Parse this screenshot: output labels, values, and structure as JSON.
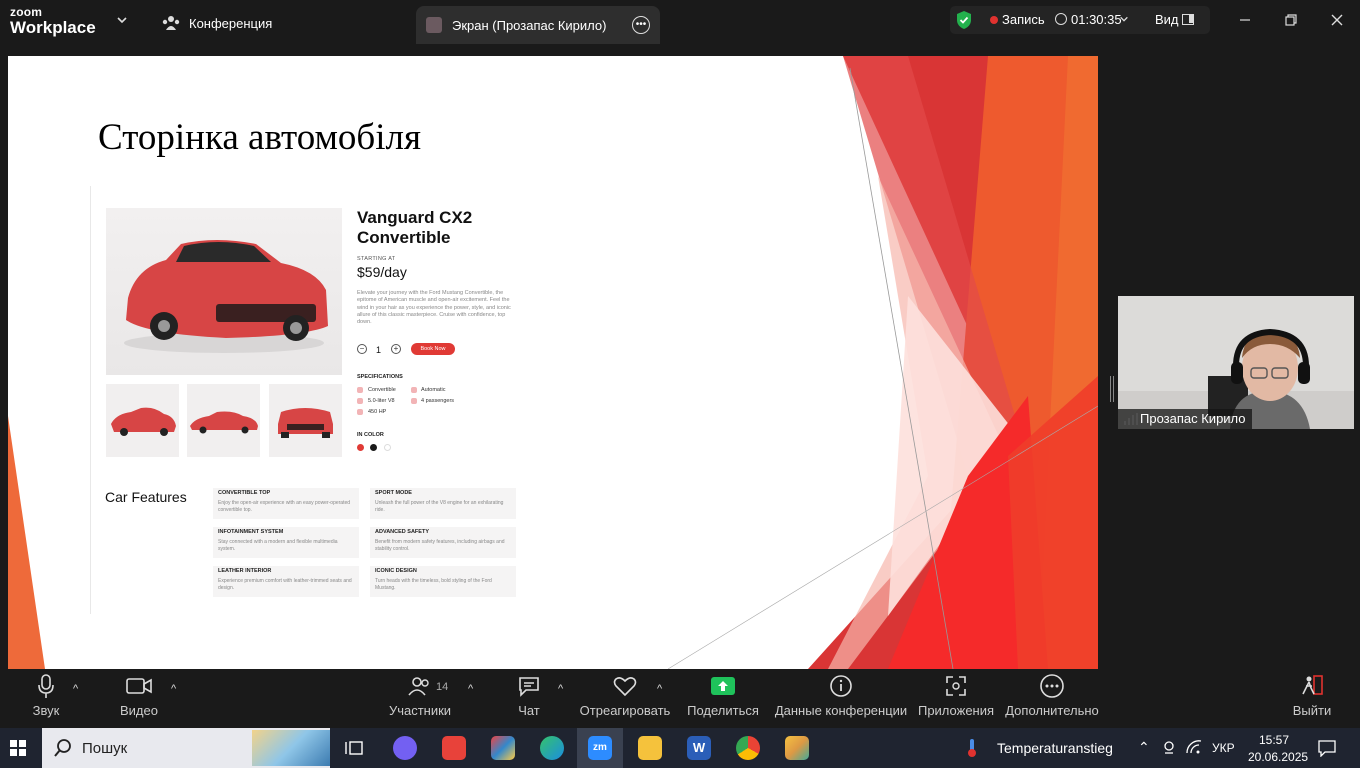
{
  "app": {
    "logo_line1": "zoom",
    "logo_line2": "Workplace",
    "meeting_tab": "Конференция",
    "share_tab": "Экран (Прозапас Кирило)",
    "recording_label": "Запись",
    "timer": "01:30:35",
    "view_label": "Вид"
  },
  "slide": {
    "title": "Сторінка автомобіля",
    "car_name": "Vanguard CX2 Convertible",
    "starting_at": "STARTING AT",
    "price": "$59/day",
    "description": "Elevate your journey with the Ford Mustang Convertible, the epitome of American muscle and open-air excitement. Feel the wind in your hair as you experience the power, style, and iconic allure of this classic masterpiece. Cruise with confidence, top down.",
    "quantity": "1",
    "book_button": "Book Now",
    "specifications_title": "SPECIFICATIONS",
    "specs": [
      "Convertible",
      "Automatic",
      "5.0-liter V8",
      "4 passengers",
      "450 HP"
    ],
    "in_color": "IN COLOR",
    "colors": [
      "#e03a35",
      "#1a1a1a",
      "#ffffff"
    ],
    "features_title": "Car Features",
    "features": [
      {
        "title": "CONVERTIBLE TOP",
        "desc": "Enjoy the open-air experience with an easy power-operated convertible top."
      },
      {
        "title": "SPORT MODE",
        "desc": "Unleash the full power of the V8 engine for an exhilarating ride."
      },
      {
        "title": "INFOTAINMENT SYSTEM",
        "desc": "Stay connected with a modern and flexible multimedia system."
      },
      {
        "title": "ADVANCED SAFETY",
        "desc": "Benefit from modern safety features, including airbags and stability control."
      },
      {
        "title": "LEATHER INTERIOR",
        "desc": "Experience premium comfort with leather-trimmed seats and design."
      },
      {
        "title": "ICONIC DESIGN",
        "desc": "Turn heads with the timeless, bold styling of the Ford Mustang."
      }
    ]
  },
  "video": {
    "participant_name": "Прозапас Кирило"
  },
  "toolbar": {
    "audio": "Звук",
    "video": "Видео",
    "participants": "Участники",
    "participants_count": "14",
    "chat": "Чат",
    "react": "Отреагировать",
    "share": "Поделиться",
    "meeting_info": "Данные конференции",
    "apps": "Приложения",
    "more": "Дополнительно",
    "leave": "Выйти"
  },
  "taskbar": {
    "search_placeholder": "Пошук",
    "weather": "Temperaturanstieg",
    "language": "УКР",
    "time": "15:57",
    "date": "20.06.2025"
  },
  "colors": {
    "accent_red": "#e03a35",
    "share_green": "#1fc25b",
    "zoom_dark": "#1a1a1a"
  }
}
